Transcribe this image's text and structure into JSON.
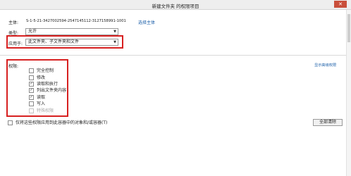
{
  "window": {
    "title": "新建文件夹 的权限项目",
    "close_glyph": "✕"
  },
  "principal": {
    "label": "主体:",
    "value": "S-1-5-21-3427002594-2547145112-3127158991-1001",
    "select_link": "选择主体"
  },
  "type": {
    "label": "类型:",
    "value": "允许"
  },
  "applies_to": {
    "label": "应用于:",
    "value": "此文件夹、子文件夹和文件"
  },
  "permissions": {
    "title": "权限:",
    "advanced_link": "显示高级权限",
    "items": [
      {
        "label": "完全控制",
        "checked": false,
        "enabled": true
      },
      {
        "label": "修改",
        "checked": false,
        "enabled": true
      },
      {
        "label": "读取和执行",
        "checked": true,
        "enabled": true
      },
      {
        "label": "列出文件夹内容",
        "checked": true,
        "enabled": true
      },
      {
        "label": "读取",
        "checked": true,
        "enabled": true
      },
      {
        "label": "写入",
        "checked": false,
        "enabled": true
      },
      {
        "label": "特殊权限",
        "checked": false,
        "enabled": false
      }
    ]
  },
  "apply_only": {
    "label": "仅将这些权限应用到此容器中的对象和/或容器(T)",
    "checked": false
  },
  "clear_all_button": "全部清除",
  "colors": {
    "highlight": "#d72020",
    "link": "#1a5ea8",
    "close_button": "#c94f3b"
  }
}
